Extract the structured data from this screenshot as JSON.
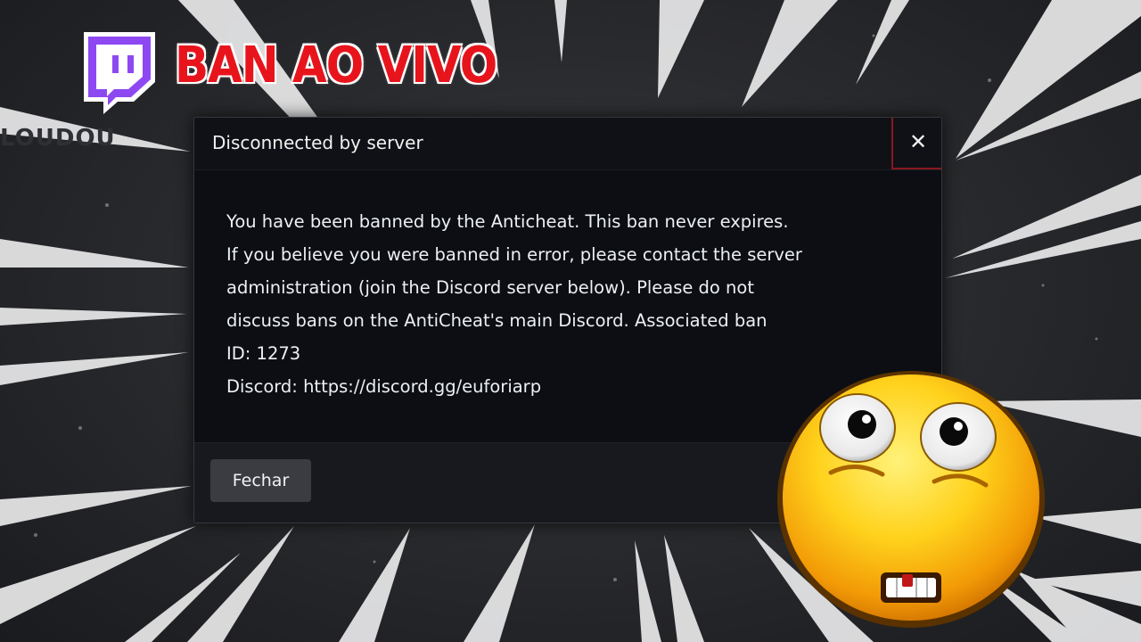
{
  "thumbnail": {
    "title": "BAN AO VIVO",
    "logo_icon": "twitch-icon",
    "logo_color": "#9146ff",
    "title_color": "#e8141c",
    "reaction_icon": "nervous-emoji-icon"
  },
  "dialog": {
    "title": "Disconnected by server",
    "close_icon": "✕",
    "close_color": "#8a1820",
    "body_lines": [
      "You have been banned by the Anticheat. This ban never expires.",
      "If you believe you were banned in error, please contact the server",
      "administration (join the Discord server below). Please do not",
      "discuss bans on the AntiCheat's main Discord. Associated ban",
      "ID: 1273",
      "Discord: https://discord.gg/euforiarp"
    ],
    "footer_button": "Fechar"
  }
}
